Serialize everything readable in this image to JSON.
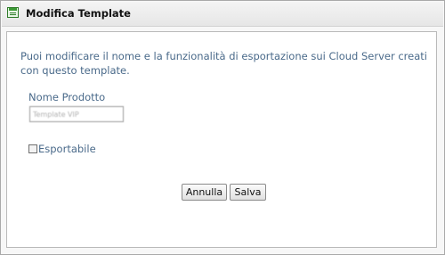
{
  "window": {
    "title": "Modifica Template",
    "icon": "template-form-icon"
  },
  "form": {
    "description": "Puoi modificare il nome e la funzionalità di esportazione sui Cloud Server creati con questo template.",
    "product_name_label": "Nome Prodotto",
    "product_name_value": "Template VIP",
    "exportable_label": "Esportabile",
    "exportable_checked": false
  },
  "buttons": {
    "cancel_label": "Annulla",
    "save_label": "Salva"
  },
  "colors": {
    "label_text": "#4a6a8a",
    "icon_green": "#3c9b35"
  }
}
